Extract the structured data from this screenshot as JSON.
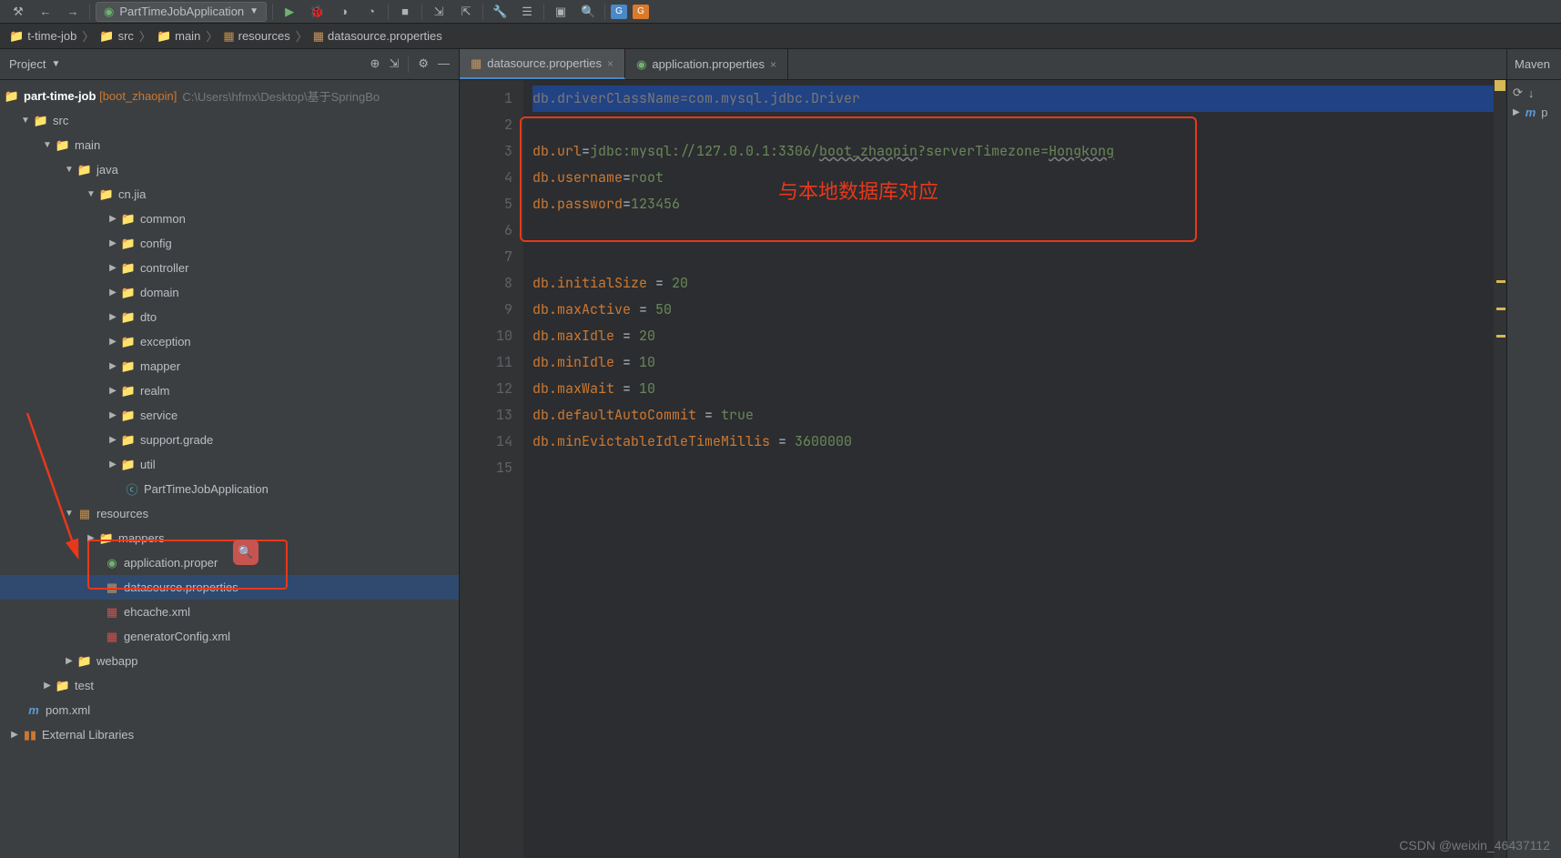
{
  "toolbar": {
    "run_config": "PartTimeJobApplication"
  },
  "breadcrumbs": {
    "items": [
      "t-time-job",
      "src",
      "main",
      "resources",
      "datasource.properties"
    ]
  },
  "project": {
    "title": "Project",
    "root": {
      "name": "part-time-job",
      "module": "[boot_zhaopin]",
      "path": "C:\\Users\\hfmx\\Desktop\\基于SpringBo"
    },
    "tree": {
      "src": "src",
      "main": "main",
      "java": "java",
      "cnjia": "cn.jia",
      "pkgs": [
        "common",
        "config",
        "controller",
        "domain",
        "dto",
        "exception",
        "mapper",
        "realm",
        "service",
        "support.grade",
        "util"
      ],
      "app_class": "PartTimeJobApplication",
      "resources": "resources",
      "mappers": "mappers",
      "res_files": [
        "application.proper",
        "datasource.properties",
        "ehcache.xml",
        "generatorConfig.xml"
      ],
      "webapp": "webapp",
      "test": "test",
      "pom": "pom.xml",
      "ext_lib": "External Libraries"
    }
  },
  "tabs": {
    "t1": "datasource.properties",
    "t2": "application.properties"
  },
  "code": {
    "l1_k": "db.driverClassName",
    "l1_v": "com.mysql.jdbc.Driver",
    "l3_k": "db.url",
    "l3_v1": "jdbc:mysql://127.0.0.1:3306/",
    "l3_v2": "boot_zhaopin",
    "l3_v3": "?serverTimezone=",
    "l3_v4": "Hongkong",
    "l4_k": "db.username",
    "l4_v": "root",
    "l5_k": "db.password",
    "l5_v": "123456",
    "l8_k": "db.initialSize",
    "l8_v": "20",
    "l9_k": "db.maxActive",
    "l9_v": "50",
    "l10_k": "db.maxIdle",
    "l10_v": "20",
    "l11_k": "db.minIdle",
    "l11_v": "10",
    "l12_k": "db.maxWait",
    "l12_v": "10",
    "l13_k": "db.defaultAutoCommit",
    "l13_v": "true",
    "l14_k": "db.minEvictableIdleTimeMillis",
    "l14_v": "3600000"
  },
  "annotation": "与本地数据库对应",
  "maven": {
    "title": "Maven",
    "item": "p"
  },
  "watermark": "CSDN @weixin_46437112",
  "line_numbers": [
    "1",
    "2",
    "3",
    "4",
    "5",
    "6",
    "7",
    "8",
    "9",
    "10",
    "11",
    "12",
    "13",
    "14",
    "15"
  ]
}
